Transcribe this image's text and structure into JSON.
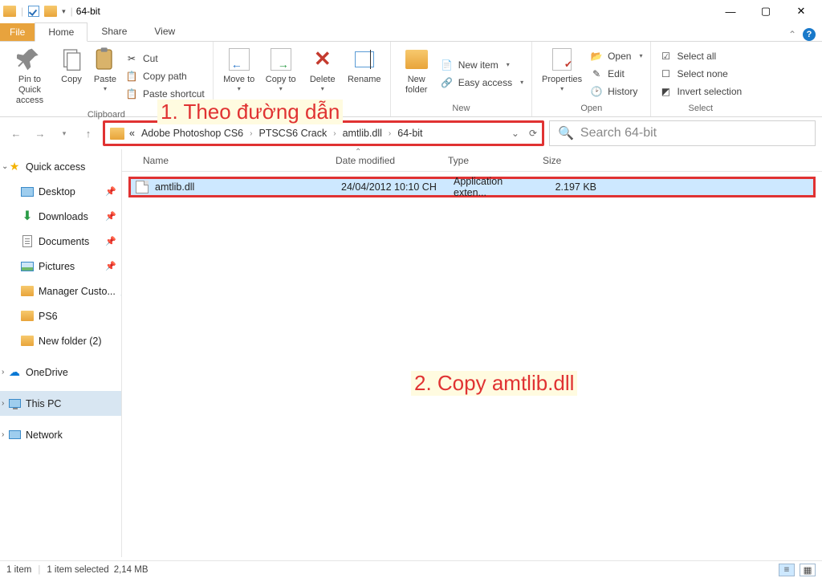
{
  "window": {
    "title": "64-bit"
  },
  "tabs": {
    "file": "File",
    "home": "Home",
    "share": "Share",
    "view": "View"
  },
  "ribbon": {
    "clipboard": {
      "label": "Clipboard",
      "pin": "Pin to Quick access",
      "copy": "Copy",
      "paste": "Paste",
      "cut": "Cut",
      "copy_path": "Copy path",
      "paste_shortcut": "Paste shortcut"
    },
    "organize": {
      "move_to": "Move to",
      "copy_to": "Copy to",
      "delete": "Delete",
      "rename": "Rename"
    },
    "new": {
      "label": "New",
      "new_folder": "New folder",
      "new_item": "New item",
      "easy_access": "Easy access"
    },
    "open": {
      "label": "Open",
      "properties": "Properties",
      "open": "Open",
      "edit": "Edit",
      "history": "History"
    },
    "select": {
      "label": "Select",
      "select_all": "Select all",
      "select_none": "Select none",
      "invert": "Invert selection"
    }
  },
  "breadcrumb": {
    "prefix": "«",
    "parts": [
      "Adobe Photoshop CS6",
      "PTSCS6 Crack",
      "amtlib.dll",
      "64-bit"
    ]
  },
  "search": {
    "placeholder": "Search 64-bit"
  },
  "columns": {
    "name": "Name",
    "date": "Date modified",
    "type": "Type",
    "size": "Size"
  },
  "file": {
    "name": "amtlib.dll",
    "date": "24/04/2012 10:10 CH",
    "type": "Application exten...",
    "size": "2.197 KB"
  },
  "sidebar": {
    "quick": "Quick access",
    "desktop": "Desktop",
    "downloads": "Downloads",
    "documents": "Documents",
    "pictures": "Pictures",
    "manager": "Manager Custo...",
    "ps6": "PS6",
    "newfolder": "New folder (2)",
    "onedrive": "OneDrive",
    "thispc": "This PC",
    "network": "Network"
  },
  "status": {
    "count": "1 item",
    "selected": "1 item selected",
    "size": "2,14 MB"
  },
  "annotations": {
    "a1": "1. Theo đường dẫn",
    "a2": "2. Copy amtlib.dll"
  }
}
